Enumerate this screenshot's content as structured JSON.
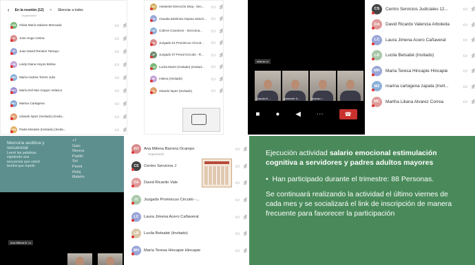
{
  "panel1": {
    "header": "En la reunión (12)",
    "mute_all": "Silenciar a todos",
    "organizer_partial": "Organizador",
    "rows": [
      {
        "ini": "OM",
        "name": "Olivia María Salazar Moncada",
        "color": "#7ab87a"
      },
      {
        "ini": "JC",
        "name": "Jose Hugo Cetina",
        "color": "#d98a8a"
      },
      {
        "ini": "JT",
        "name": "Juan David Rendon Tamayo",
        "color": "#9aa6d8"
      },
      {
        "ini": "LB",
        "name": "Leidy Diana Hoyos Bolina",
        "color": "#c2a3d6"
      },
      {
        "ini": "MJ",
        "name": "María Andrea Torres Julio",
        "color": "#8cb0d8"
      },
      {
        "ini": "MV",
        "name": "María Del Mar Aragon Velasco",
        "color": "#9c8fd0"
      },
      {
        "ini": "MC",
        "name": "Marina Cartagena",
        "color": "#86a8d4"
      },
      {
        "ini": "OL",
        "name": "orlando lopez (Invitado) (Invita...",
        "color": "#e1a070"
      },
      {
        "ini": "PM",
        "name": "Paola Morales (Invitado) (Invita...",
        "color": "#e2b060"
      }
    ]
  },
  "panel2": {
    "rows": [
      {
        "ini": "AS",
        "name": "Asistente Dirección Dsaj - Sec...",
        "color": "#d4b060"
      },
      {
        "ini": "CE",
        "name": "Claudia Edelmira Ospina Sánch...",
        "color": "#9aa6d8"
      },
      {
        "ini": "CE",
        "name": "Cobros Coactivos - Secciona...",
        "color": "#8cb0d8"
      },
      {
        "ini": "JU",
        "name": "Juzgado 01 Promiscuo Circuit...",
        "color": "#d98a8a"
      },
      {
        "ini": "JP",
        "name": "Juzgado 07 Penal Circuito - R...",
        "color": "#6a8a6a"
      },
      {
        "ini": "LM",
        "name": "Lucila Marín (Invitado) (Invitad...",
        "color": "#7ab87a"
      },
      {
        "ini": "MI",
        "name": "milena (Invitado)",
        "color": "#c2a3d6"
      },
      {
        "ini": "OL",
        "name": "orlando lopez (Invitado)",
        "color": "#e1a070"
      }
    ]
  },
  "panel3": {
    "main_label": "milena",
    "tiles": [
      "Claudia E...",
      "Asistente D...",
      "orlando l...",
      ""
    ]
  },
  "panel4": {
    "rows": [
      {
        "ini": "CS",
        "name": "Centro Servicios Judiciales 12...",
        "color": "#444"
      },
      {
        "ini": "DA",
        "name": "David Ricardo Valencia Arboleda",
        "color": "#e09a9a"
      },
      {
        "ini": "LC",
        "name": "Laura Jimena Acero Cañaveral",
        "color": "#9aa6d8"
      },
      {
        "ini": "LB",
        "name": "Lucila Betsabé  (Invitado)",
        "color": "#a8c8a8"
      },
      {
        "ini": "MH",
        "name": "María Teresa Hincapie Hincapie",
        "color": "#9aa6d8"
      },
      {
        "ini": "MZ",
        "name": "marina cartagena zapata (Invit...",
        "color": "#8cb0d8"
      },
      {
        "ini": "MC",
        "name": "Martha Liliana Alvarez Correa",
        "color": "#e09a9a"
      }
    ]
  },
  "panel5": {
    "title": "Memoria auditiva y secuencial",
    "lines": [
      "Leeré las palabras",
      "siguiendo una",
      "secuencia que usted",
      "tendrá que repetir"
    ],
    "words": [
      "+7",
      "Gato",
      "Nevera",
      "Pasillo",
      "Sol",
      "Pared",
      "Reloj",
      "Maletín"
    ],
    "self_label": "Ana Milena B."
  },
  "panel6": {
    "organizer": "Organizador",
    "rows": [
      {
        "ini": "AO",
        "name": "Ana Milena Barrera Ocampo",
        "color": "#d98a8a"
      },
      {
        "ini": "CS",
        "name": "Centro Servicios J",
        "color": "#444"
      },
      {
        "ini": "DA",
        "name": "David Ricardo Vale",
        "color": "#e09a9a"
      },
      {
        "ini": "JC",
        "name": "Juzgado Promiscuo Circuito -...",
        "color": "#a8c8a8"
      },
      {
        "ini": "LC",
        "name": "Laura Jimena Acero Cañaveral",
        "color": "#9aa6d8"
      },
      {
        "ini": "LB",
        "name": "Lucila Betsabé  (Invitado)",
        "color": "#d8c8a8"
      },
      {
        "ini": "MH",
        "name": "María Teresa Hincapie Hincapie",
        "color": "#9aa6d8"
      }
    ]
  },
  "panel7": {
    "p1_a": "Ejecución actividad ",
    "p1_b": "salario emocional estimulación cognitiva a servidores y padres adultos mayores",
    "bullet": "Han participado durante el trimestre:  88 Personas.",
    "p3": "Se continuará realizando la actividad el último viernes de cada mes y se socializará el link de inscripción de manera frecuente para favorecer la participación"
  }
}
